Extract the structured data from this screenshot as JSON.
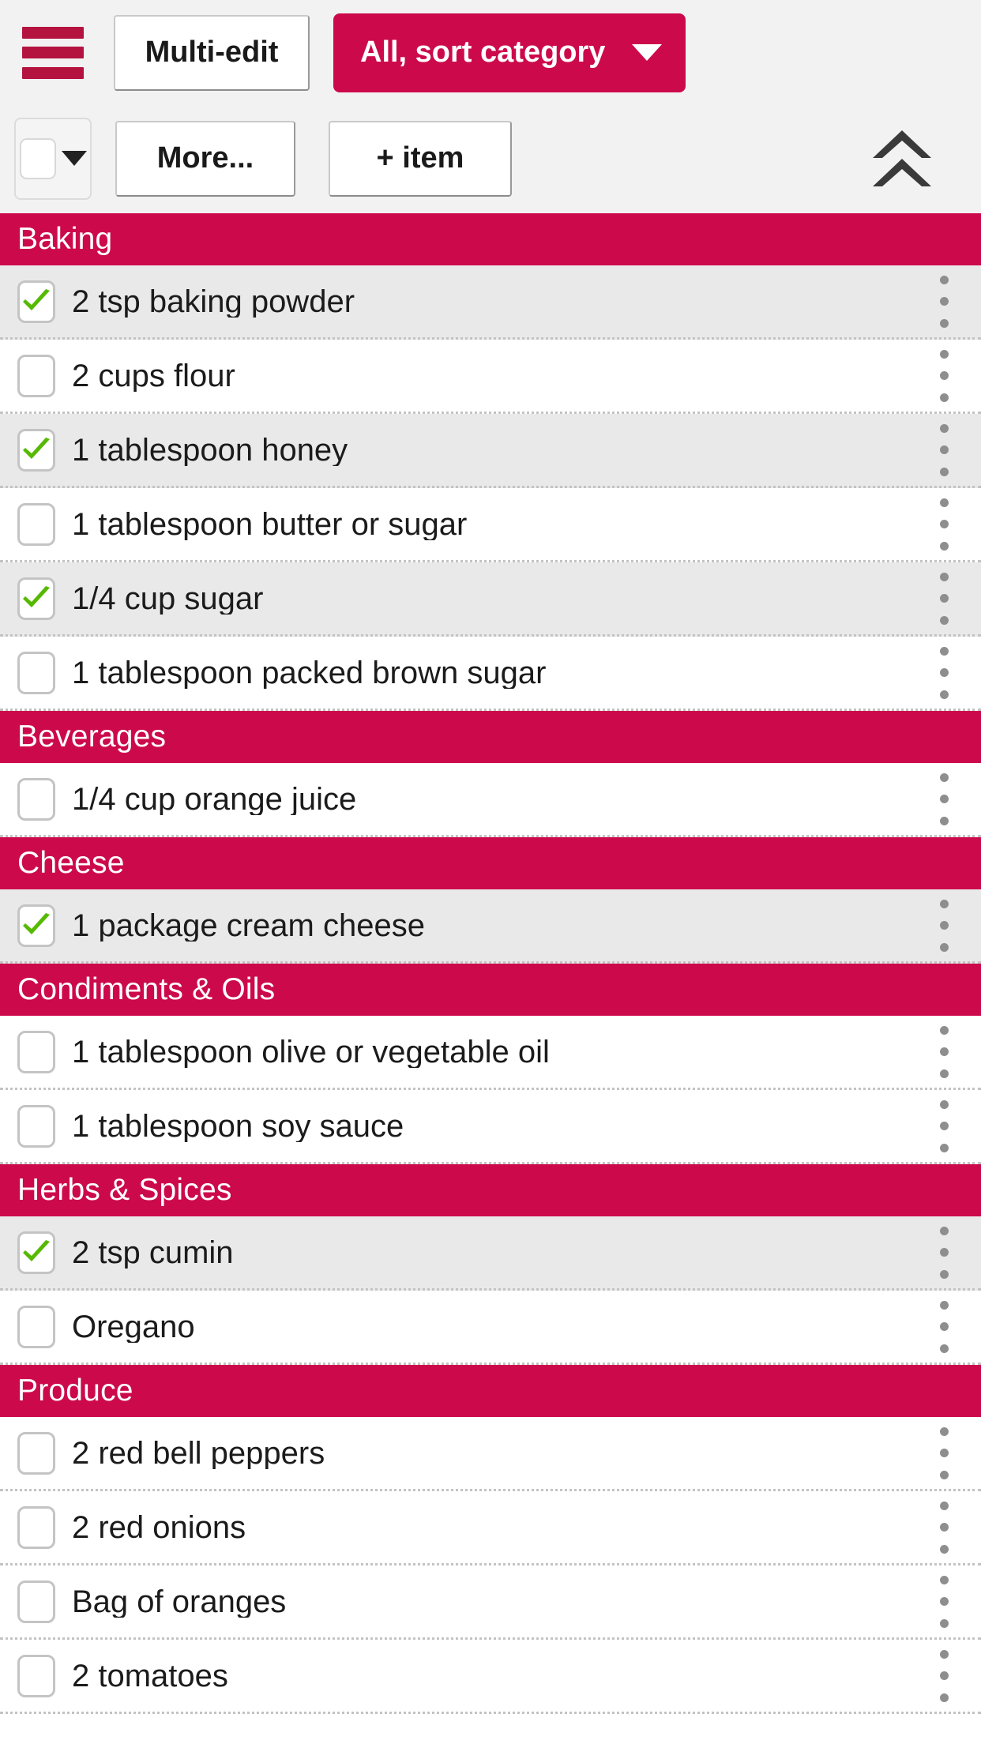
{
  "toolbar": {
    "menu_icon": "hamburger-menu-icon",
    "multi_edit_label": "Multi-edit",
    "sort_label": "All, sort category",
    "sort_caret_icon": "chevron-down-icon",
    "check_all_caret_icon": "chevron-down-icon",
    "more_label": "More...",
    "add_item_label": "+ item",
    "collapse_icon": "double-chevron-up-icon"
  },
  "colors": {
    "accent": "#cc0a4b",
    "menu_icon": "#b4123f",
    "checked_row_bg": "#e9e9e9",
    "check_mark": "#56b900",
    "page_bg": "#ffffff",
    "toolbar_bg": "#f2f2f2"
  },
  "list": {
    "sections": [
      {
        "category": "Baking",
        "items": [
          {
            "label": "2 tsp baking powder",
            "checked": true
          },
          {
            "label": "2 cups flour",
            "checked": false
          },
          {
            "label": "1 tablespoon honey",
            "checked": true
          },
          {
            "label": "1 tablespoon butter or sugar",
            "checked": false
          },
          {
            "label": "1/4 cup sugar",
            "checked": true
          },
          {
            "label": "1 tablespoon packed brown sugar",
            "checked": false
          }
        ]
      },
      {
        "category": "Beverages",
        "items": [
          {
            "label": "1/4 cup orange juice",
            "checked": false
          }
        ]
      },
      {
        "category": "Cheese",
        "items": [
          {
            "label": "1 package cream cheese",
            "checked": true
          }
        ]
      },
      {
        "category": "Condiments & Oils",
        "items": [
          {
            "label": "1 tablespoon olive or vegetable oil",
            "checked": false
          },
          {
            "label": "1 tablespoon soy sauce",
            "checked": false
          }
        ]
      },
      {
        "category": "Herbs & Spices",
        "items": [
          {
            "label": "2 tsp cumin",
            "checked": true
          },
          {
            "label": "Oregano",
            "checked": false
          }
        ]
      },
      {
        "category": "Produce",
        "items": [
          {
            "label": "2 red bell peppers",
            "checked": false
          },
          {
            "label": "2 red onions",
            "checked": false
          },
          {
            "label": "Bag of oranges",
            "checked": false
          },
          {
            "label": "2 tomatoes",
            "checked": false
          }
        ]
      }
    ]
  }
}
